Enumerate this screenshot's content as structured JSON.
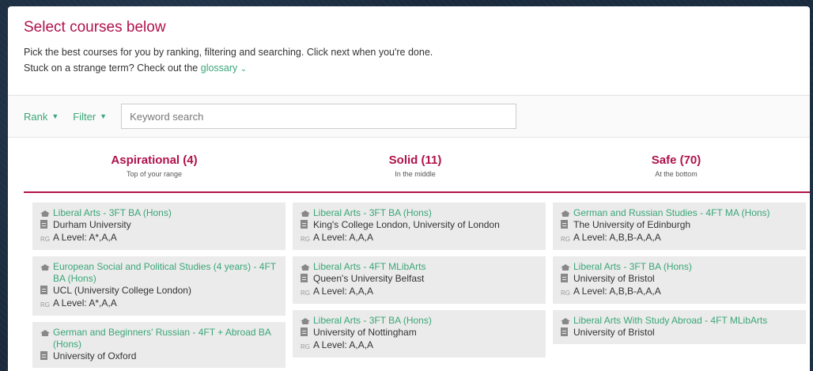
{
  "intro": {
    "title": "Select courses below",
    "line1": "Pick the best courses for you by ranking, filtering and searching. Click next when you're done.",
    "line2_prefix": "Stuck on a strange term? Check out the",
    "glossary_link": "glossary",
    "glossary_chevron": "⌄"
  },
  "toolbar": {
    "rank_label": "Rank",
    "filter_label": "Filter",
    "caret": "▼",
    "search_placeholder": "Keyword search"
  },
  "columns": [
    {
      "heading": "Aspirational (4)",
      "subheading": "Top of your range",
      "cards": [
        {
          "course": "Liberal Arts - 3FT BA (Hons)",
          "university": "Durham University",
          "rg": "RG",
          "level": "A Level: A*,A,A"
        },
        {
          "course": "European Social and Political Studies (4 years) - 4FT BA (Hons)",
          "university": "UCL (University College London)",
          "rg": "RG",
          "level": "A Level: A*,A,A"
        },
        {
          "course": "German and Beginners' Russian - 4FT + Abroad BA (Hons)",
          "university": "University of Oxford",
          "rg": "RG",
          "level": ""
        }
      ]
    },
    {
      "heading": "Solid (11)",
      "subheading": "In the middle",
      "cards": [
        {
          "course": "Liberal Arts - 3FT BA (Hons)",
          "university": "King's College London, University of London",
          "rg": "RG",
          "level": "A Level: A,A,A"
        },
        {
          "course": "Liberal Arts - 4FT MLibArts",
          "university": "Queen's University Belfast",
          "rg": "RG",
          "level": "A Level: A,A,A"
        },
        {
          "course": "Liberal Arts - 3FT BA (Hons)",
          "university": "University of Nottingham",
          "rg": "RG",
          "level": "A Level: A,A,A"
        }
      ]
    },
    {
      "heading": "Safe (70)",
      "subheading": "At the bottom",
      "cards": [
        {
          "course": "German and Russian Studies - 4FT MA (Hons)",
          "university": "The University of Edinburgh",
          "rg": "RG",
          "level": "A Level: A,B,B-A,A,A"
        },
        {
          "course": "Liberal Arts - 3FT BA (Hons)",
          "university": "University of Bristol",
          "rg": "RG",
          "level": "A Level: A,B,B-A,A,A"
        },
        {
          "course": "Liberal Arts With Study Abroad - 4FT MLibArts",
          "university": "University of Bristol",
          "rg": "RG",
          "level": ""
        }
      ]
    }
  ],
  "colors": {
    "accent": "#b0124b",
    "link": "#3aa678",
    "card": "#ebebeb"
  },
  "icons": {
    "course": "graduation-cap-icon",
    "university": "building-icon",
    "rg": "rg-badge"
  }
}
